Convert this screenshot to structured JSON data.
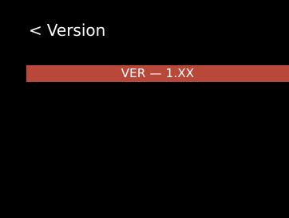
{
  "header": {
    "back_glyph": "<",
    "title": "Version"
  },
  "version_row": {
    "label": "VER",
    "separator": "—",
    "value": "1.XX"
  },
  "colors": {
    "background": "#000000",
    "highlight": "#b8483a",
    "text": "#ffffff"
  }
}
